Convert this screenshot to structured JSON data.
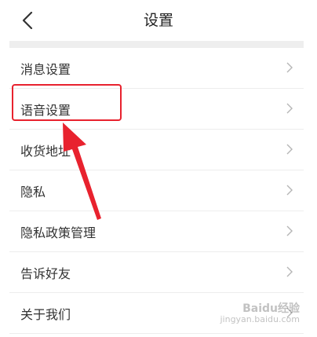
{
  "header": {
    "title": "设置",
    "back_icon": "chevron-left-icon"
  },
  "settings": {
    "items": [
      {
        "label": "消息设置"
      },
      {
        "label": "语音设置"
      },
      {
        "label": "收货地址"
      },
      {
        "label": "隐私"
      },
      {
        "label": "隐私政策管理"
      },
      {
        "label": "告诉好友"
      },
      {
        "label": "关于我们"
      }
    ],
    "chevron_icon": "chevron-right-icon"
  },
  "annotation": {
    "highlight_color": "#e8222e",
    "arrow_color": "#e8222e"
  },
  "watermark": {
    "brand": "Baidu经验",
    "url": "jingyan.baidu.com"
  }
}
